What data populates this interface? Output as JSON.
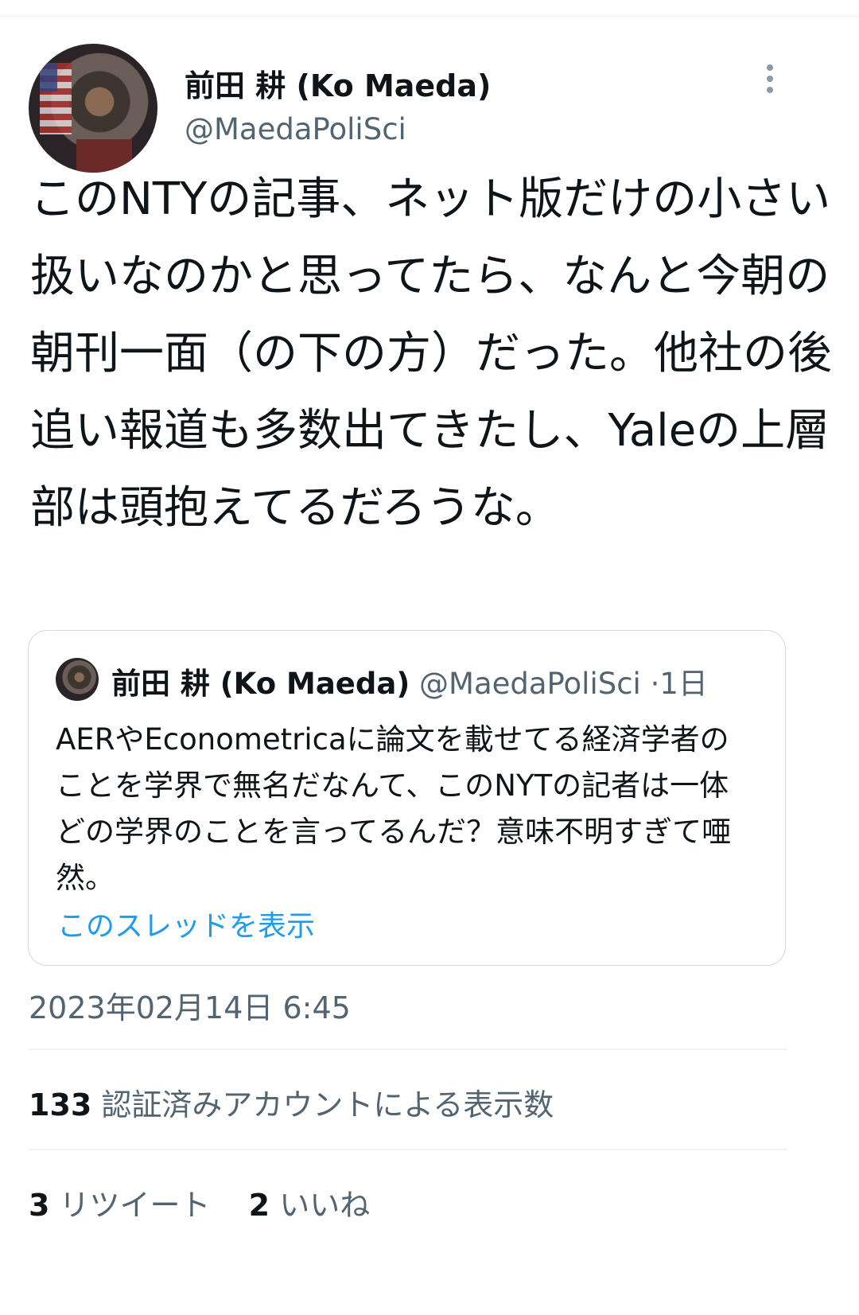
{
  "author": {
    "display_name": "前田 耕 (Ko Maeda)",
    "handle": "@MaedaPoliSci"
  },
  "tweet": {
    "text": "このNTYの記事、ネット版だけの小さい扱いなのかと思ってたら、なんと今朝の朝刊一面（の下の方）だった。他社の後追い報道も多数出てきたし、Yaleの上層部は頭抱えてるだろうな。",
    "timestamp": "2023年02月14日 6:45"
  },
  "quote": {
    "display_name": "前田 耕 (Ko Maeda)",
    "handle": "@MaedaPoliSci",
    "separator": "·",
    "time": "1日",
    "text": "AERやEconometricaに論文を載せてる経済学者のことを学界で無名だなんて、このNYTの記者は一体どの学界のことを言ってるんだ？意味不明すぎて唖然。",
    "show_thread_label": "このスレッドを表示"
  },
  "views": {
    "count": "133",
    "label": "認証済みアカウントによる表示数"
  },
  "stats": {
    "retweets_count": "3",
    "retweets_label": "リツイート",
    "likes_count": "2",
    "likes_label": "いいね"
  }
}
